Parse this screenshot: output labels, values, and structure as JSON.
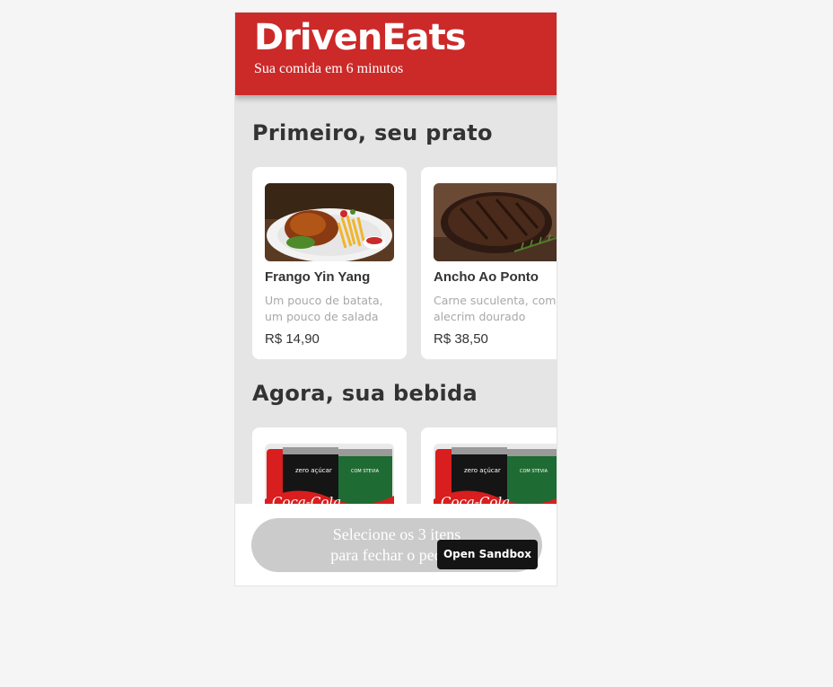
{
  "header": {
    "brand": "DrivenEats",
    "tagline": "Sua comida em 6 minutos"
  },
  "sections": [
    {
      "title": "Primeiro, seu prato",
      "items": [
        {
          "name": "Frango Yin Yang",
          "description": "Um pouco de batata, um pouco de salada",
          "price": "R$ 14,90",
          "image": "roast-chicken-fries-plate"
        },
        {
          "name": "Ancho Ao Ponto",
          "description": "Carne suculenta, com alecrim dourado",
          "price": "R$ 38,50",
          "image": "grilled-steak-rosemary"
        }
      ]
    },
    {
      "title": "Agora, sua bebida",
      "items": [
        {
          "name": "",
          "description": "",
          "price": "",
          "image": "coca-cola-cans"
        },
        {
          "name": "",
          "description": "",
          "price": "",
          "image": "coca-cola-cans"
        }
      ]
    }
  ],
  "checkout": {
    "line1": "Selecione os 3 itens",
    "line2": "para fechar o pedido"
  },
  "sandbox_button": "Open Sandbox",
  "colors": {
    "brand_red": "#cc2929",
    "checkout_disabled": "#cbcbcb",
    "background": "#e5e5e5"
  }
}
